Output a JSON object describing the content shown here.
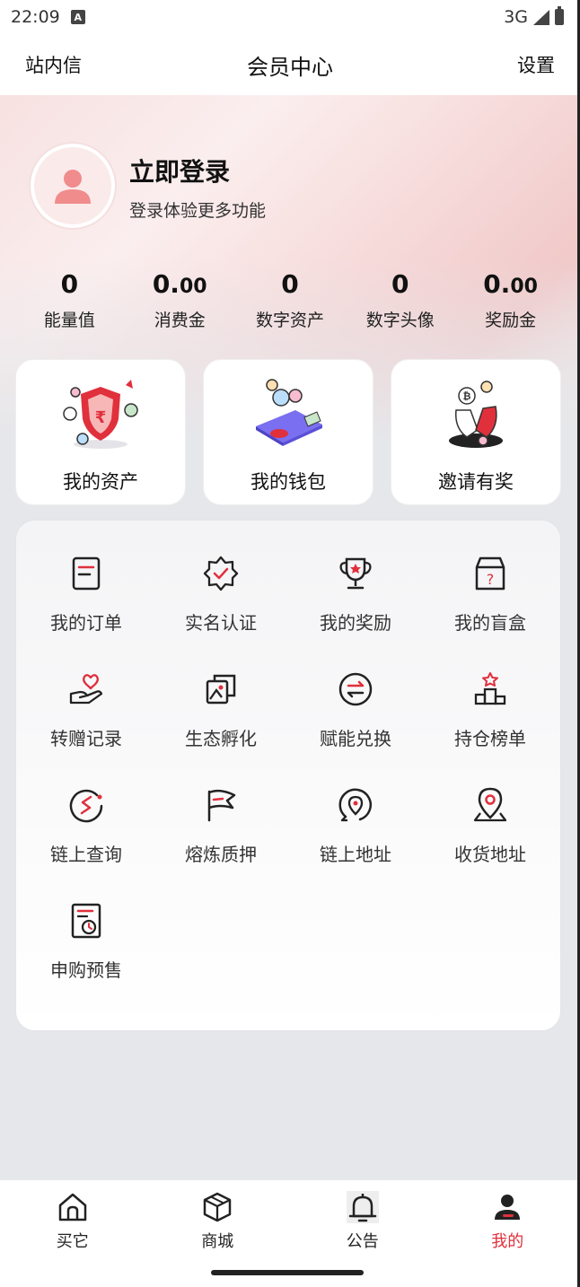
{
  "status_bar": {
    "time": "22:09",
    "network": "3G",
    "a_badge": "A"
  },
  "header": {
    "left": "站内信",
    "title": "会员中心",
    "right": "设置"
  },
  "profile": {
    "title": "立即登录",
    "subtitle": "登录体验更多功能"
  },
  "stats": [
    {
      "int": "0",
      "dec": "",
      "label": "能量值"
    },
    {
      "int": "0.",
      "dec": "00",
      "label": "消费金"
    },
    {
      "int": "0",
      "dec": "",
      "label": "数字资产"
    },
    {
      "int": "0",
      "dec": "",
      "label": "数字头像"
    },
    {
      "int": "0.",
      "dec": "00",
      "label": "奖励金"
    }
  ],
  "cards": [
    {
      "label": "我的资产",
      "icon": "shield-coins-illustration"
    },
    {
      "label": "我的钱包",
      "icon": "phone-wallet-illustration"
    },
    {
      "label": "邀请有奖",
      "icon": "handshake-bitcoin-illustration"
    }
  ],
  "menu": [
    {
      "label": "我的订单",
      "icon": "order-icon"
    },
    {
      "label": "实名认证",
      "icon": "verified-badge-icon"
    },
    {
      "label": "我的奖励",
      "icon": "trophy-icon"
    },
    {
      "label": "我的盲盒",
      "icon": "blind-box-icon"
    },
    {
      "label": "转赠记录",
      "icon": "gift-hand-icon"
    },
    {
      "label": "生态孵化",
      "icon": "incubate-icon"
    },
    {
      "label": "赋能兑换",
      "icon": "exchange-icon"
    },
    {
      "label": "持仓榜单",
      "icon": "ranking-icon"
    },
    {
      "label": "链上查询",
      "icon": "chain-query-icon"
    },
    {
      "label": "熔炼质押",
      "icon": "flag-icon"
    },
    {
      "label": "链上地址",
      "icon": "chain-location-icon"
    },
    {
      "label": "收货地址",
      "icon": "location-pin-icon"
    },
    {
      "label": "申购预售",
      "icon": "presale-doc-icon"
    }
  ],
  "tabbar": [
    {
      "label": "买它",
      "icon": "home-icon",
      "active": false
    },
    {
      "label": "商城",
      "icon": "box-icon",
      "active": false
    },
    {
      "label": "公告",
      "icon": "bell-icon",
      "active": false
    },
    {
      "label": "我的",
      "icon": "user-icon",
      "active": true
    }
  ],
  "colors": {
    "accent": "#e0303c",
    "dark": "#222222",
    "avatar_pink": "#f08c8c"
  }
}
